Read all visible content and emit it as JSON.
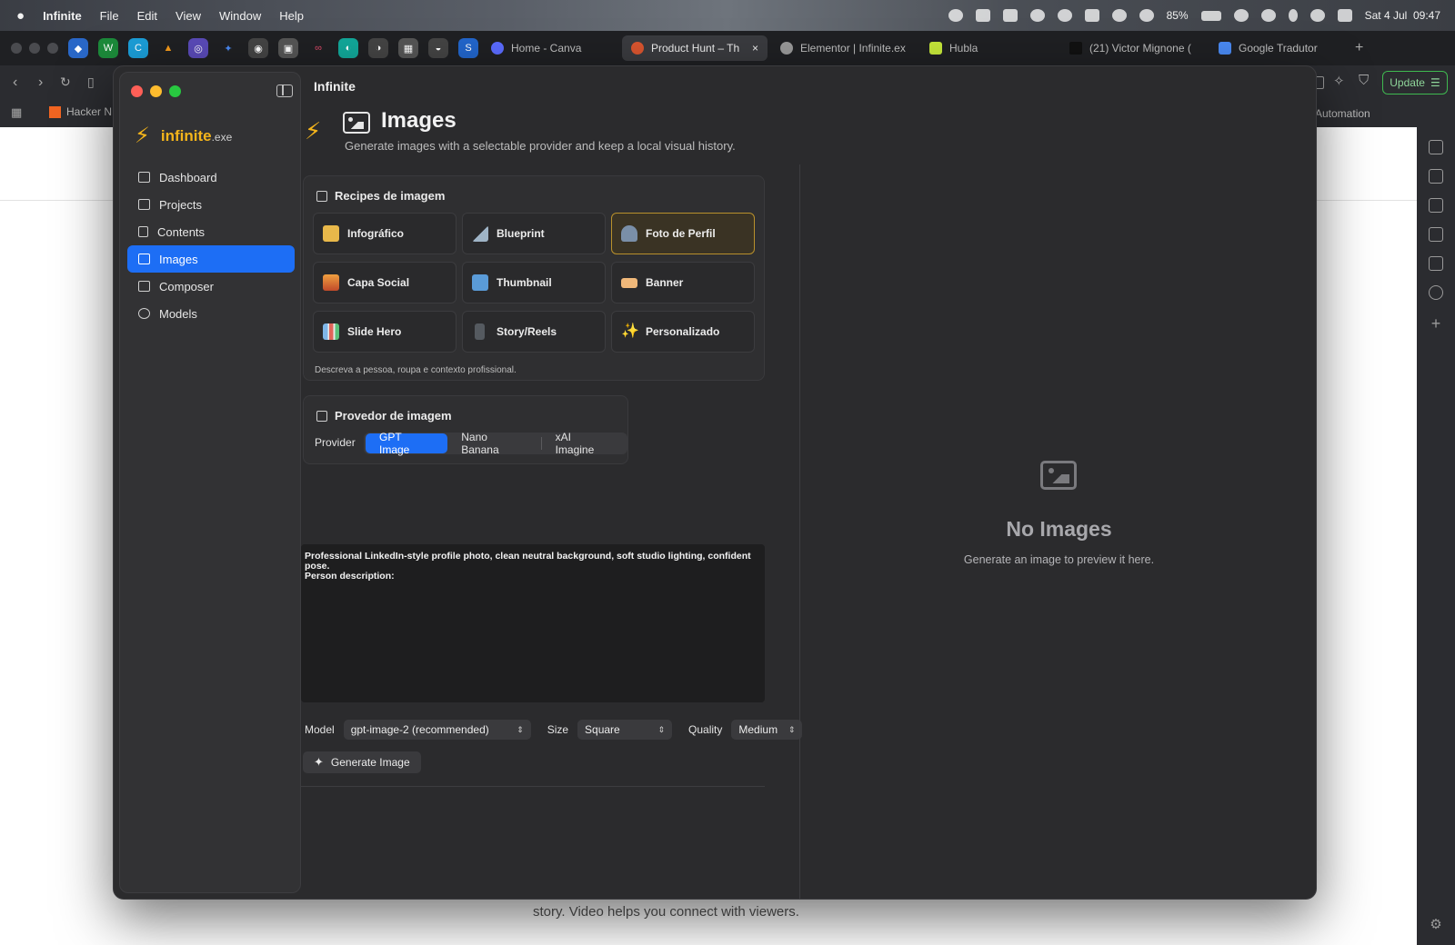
{
  "menubar": {
    "app": "Infinite",
    "items": [
      "File",
      "Edit",
      "View",
      "Window",
      "Help"
    ],
    "battery": "85%",
    "datetime": "Sat 4 Jul  09:47"
  },
  "browser": {
    "tabs": [
      {
        "label": "Home - Canva",
        "color": "#5b6cff"
      },
      {
        "label": "Product Hunt – Th",
        "color": "#da552f",
        "active": true,
        "close": "×"
      },
      {
        "label": "Elementor | Infinite.ex",
        "color": "#9a9a9a"
      },
      {
        "label": "Hubla",
        "color": "#c6e83a"
      },
      {
        "label": "(21) Victor Mignone (",
        "color": "#111111"
      },
      {
        "label": "Google Tradutor",
        "color": "#4a8af4"
      }
    ],
    "new_tab": "+",
    "update_label": "Update",
    "bookmark_hn": "Hacker N",
    "bookmark_automation": "Automation",
    "page_text": "story. Video helps you connect with viewers."
  },
  "app": {
    "window_title": "Infinite",
    "brand": "infinite",
    "brand_ext": ".exe",
    "nav": [
      {
        "label": "Dashboard",
        "icon": "grid-icon"
      },
      {
        "label": "Projects",
        "icon": "folder-icon"
      },
      {
        "label": "Contents",
        "icon": "document-icon"
      },
      {
        "label": "Images",
        "icon": "image-icon",
        "active": true
      },
      {
        "label": "Composer",
        "icon": "pencil-icon"
      },
      {
        "label": "Models",
        "icon": "cpu-icon"
      }
    ],
    "page": {
      "title": "Images",
      "subtitle": "Generate images with a selectable provider and keep a local visual history."
    },
    "recipes": {
      "title": "Recipes de imagem",
      "items": [
        {
          "label": "Infográfico",
          "icon": "chart-image-icon",
          "color": "#e8b84a"
        },
        {
          "label": "Blueprint",
          "icon": "triangle-ruler-icon",
          "color": "#9fb4c7"
        },
        {
          "label": "Foto de Perfil",
          "icon": "person-icon",
          "color": "#7a8fa8",
          "selected": true
        },
        {
          "label": "Capa Social",
          "icon": "sunset-icon",
          "color": "#e07a3a"
        },
        {
          "label": "Thumbnail",
          "icon": "play-icon",
          "color": "#5a9bd8"
        },
        {
          "label": "Banner",
          "icon": "ticket-icon",
          "color": "#f0b87a"
        },
        {
          "label": "Slide Hero",
          "icon": "bar-chart-icon",
          "color": "#7fb6e8"
        },
        {
          "label": "Story/Reels",
          "icon": "phone-icon",
          "color": "#555a60"
        },
        {
          "label": "Personalizado",
          "icon": "sparkles-icon",
          "color": "#f5c542"
        }
      ],
      "hint": "Descreva a pessoa, roupa e contexto profissional."
    },
    "provider": {
      "title": "Provedor de imagem",
      "label": "Provider",
      "options": [
        "GPT Image",
        "Nano Banana",
        "xAI Imagine"
      ],
      "selected": "GPT Image"
    },
    "prompt": "Professional LinkedIn-style profile photo, clean neutral background, soft studio lighting, confident pose.\nPerson description:",
    "controls": {
      "model_label": "Model",
      "model_value": "gpt-image-2 (recommended)",
      "size_label": "Size",
      "size_value": "Square",
      "quality_label": "Quality",
      "quality_value": "Medium"
    },
    "generate_label": "Generate Image",
    "empty": {
      "title": "No Images",
      "subtitle": "Generate an image to preview it here."
    }
  },
  "colors": {
    "accent": "#1d6ef5",
    "brand": "#f5b51b",
    "selected_border": "#b8902c"
  }
}
